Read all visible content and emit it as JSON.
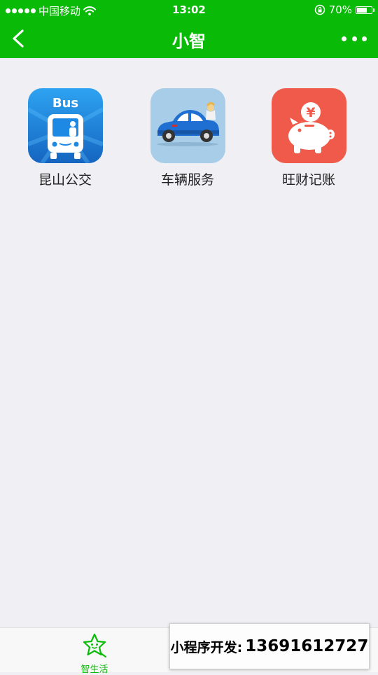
{
  "status_bar": {
    "carrier": "中国移动",
    "time": "13:02",
    "battery": "70%",
    "battery_level": 0.7
  },
  "nav": {
    "title": "小智",
    "back_icon": "chevron-left-icon",
    "more_icon": "more-dots-icon"
  },
  "apps": [
    {
      "label": "昆山公交",
      "icon": "bus-icon",
      "icon_text": "Bus",
      "color": "#1e88e5"
    },
    {
      "label": "车辆服务",
      "icon": "car-icon",
      "color": "#a7cde8"
    },
    {
      "label": "旺财记账",
      "icon": "piggy-bank-icon",
      "icon_text": "¥",
      "color": "#f05a4a"
    }
  ],
  "tabbar": {
    "tabs": [
      {
        "label": "智生活",
        "icon": "star-face-icon",
        "active": true
      }
    ]
  },
  "dev_banner": {
    "label": "小程序开发:",
    "phone": "13691612727"
  },
  "colors": {
    "brand_green": "#09bb07",
    "background": "#efeff4"
  }
}
